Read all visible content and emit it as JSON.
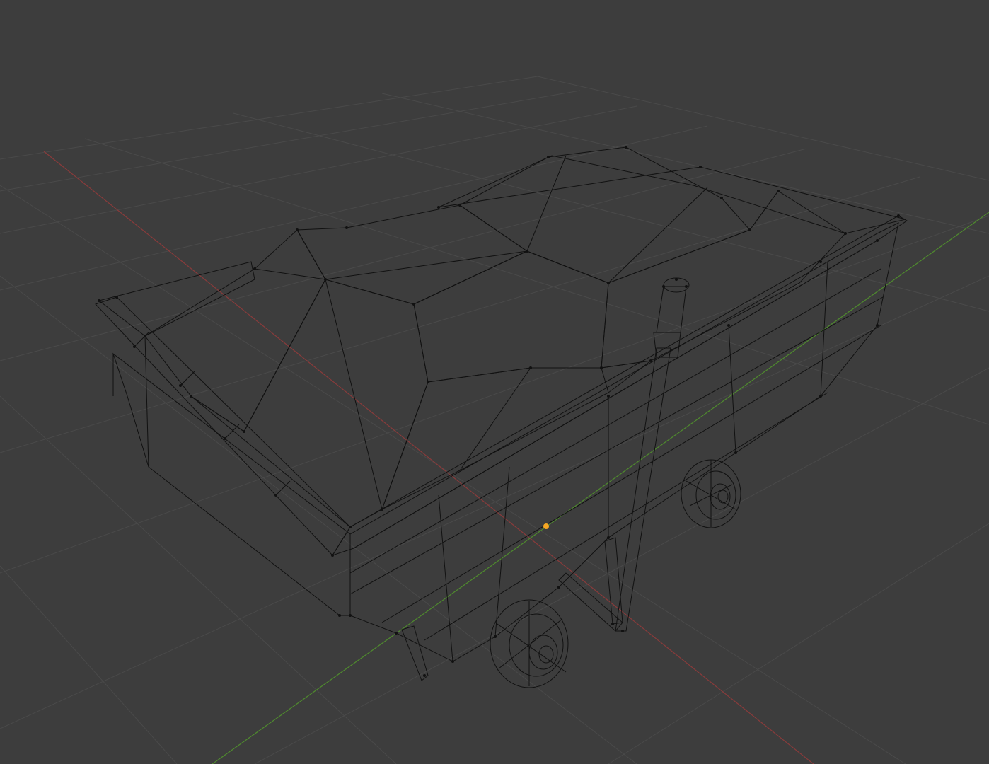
{
  "viewport": {
    "background": "#3d3d3d",
    "grid_color": "#4a4a4a",
    "x_axis_color": "#8a3b3b",
    "y_axis_color": "#4f8a2e",
    "object_origin_color": "#f5a623"
  },
  "scene": {
    "object": "ore-cart-mesh",
    "mode": "wireframe-overlay"
  }
}
